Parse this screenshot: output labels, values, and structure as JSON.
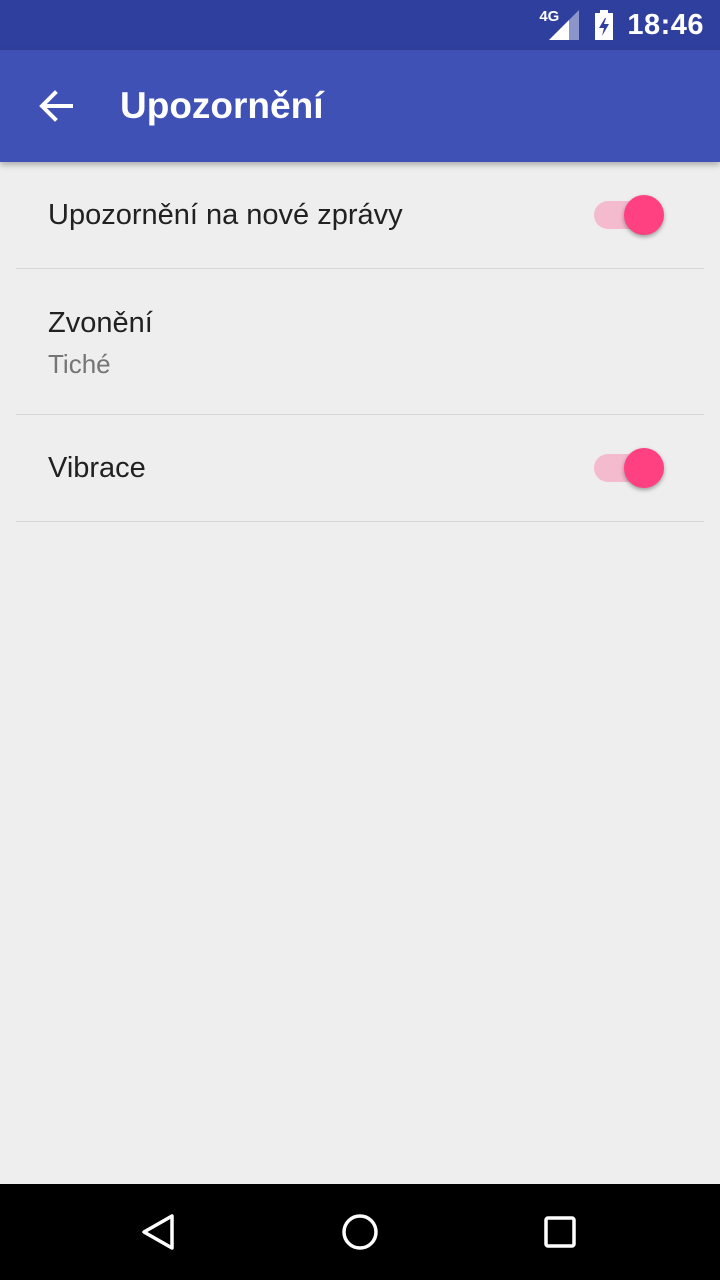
{
  "status_bar": {
    "network_type": "4G",
    "time": "18:46",
    "icons": [
      "signal-icon",
      "battery-charging-icon"
    ]
  },
  "app_bar": {
    "title": "Upozornění",
    "back_icon": "arrow-back-icon"
  },
  "settings": [
    {
      "label": "Upozornění na nové zprávy",
      "type": "switch",
      "checked": true
    },
    {
      "label": "Zvonění",
      "summary": "Tiché",
      "type": "list"
    },
    {
      "label": "Vibrace",
      "type": "switch",
      "checked": true
    }
  ],
  "nav_bar": {
    "icons": [
      "back-triangle-icon",
      "home-circle-icon",
      "recents-square-icon"
    ]
  },
  "colors": {
    "status_bar": "#2f3f9e",
    "app_bar": "#3f51b5",
    "background": "#eeeeee",
    "accent": "#ff4081",
    "switch_track": "#f4bacd"
  }
}
